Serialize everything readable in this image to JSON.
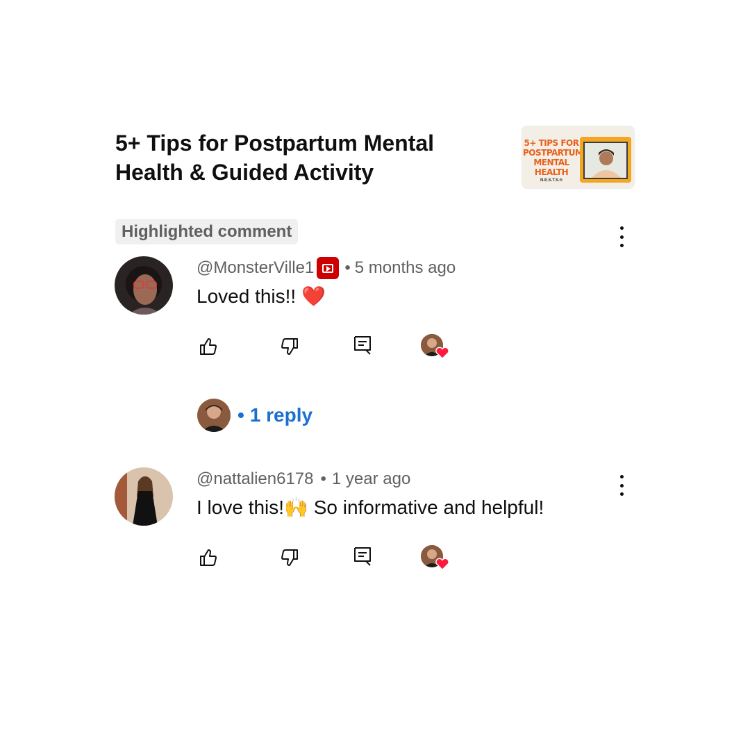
{
  "video": {
    "title": "5+ Tips for Postpartum Mental Health & Guided Activity",
    "thumbnail_text": "5+ TIPS FOR POSTPARTUM MENTAL HEALTH",
    "thumbnail_sub": "N.E.S.T.S.®"
  },
  "highlighted_label": "Highlighted comment",
  "comments": [
    {
      "author": "@MonsterVille1",
      "time": "5 months ago",
      "text": "Loved this!! ❤️",
      "has_member_badge": true
    },
    {
      "author": "@nattalien6178",
      "time": "1 year ago",
      "text": "I love this!🙌 So informative and helpful!",
      "has_member_badge": false
    }
  ],
  "replies": {
    "label": "1 reply",
    "separator": "•"
  },
  "separator": "•",
  "icons": {
    "like": "thumbs-up-icon",
    "dislike": "thumbs-down-icon",
    "reply": "reply-comment-icon",
    "creator_heart": "creator-heart-icon",
    "more": "more-vertical-icon",
    "badge": "member-badge-icon"
  },
  "colors": {
    "link": "#1a6fd1",
    "heart": "#ff1a3d",
    "badge": "#cc0000",
    "meta": "#606060"
  }
}
